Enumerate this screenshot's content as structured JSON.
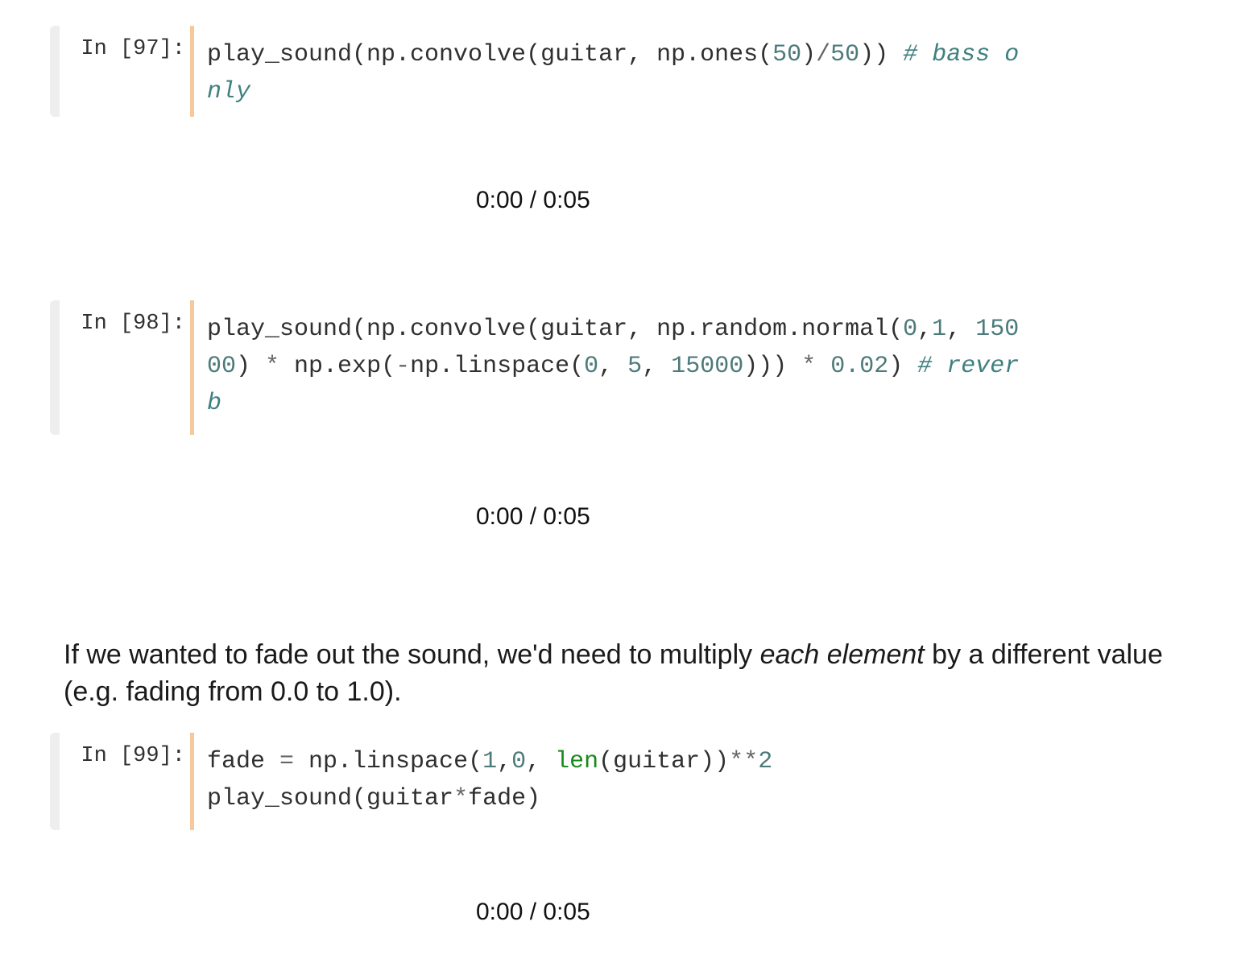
{
  "cells": [
    {
      "prompt": "In [97]:",
      "code_lines": [
        [
          {
            "t": "play_sound(np.convolve(guitar, np.ones(",
            "c": ""
          },
          {
            "t": "50",
            "c": "num"
          },
          {
            "t": ")",
            "c": ""
          },
          {
            "t": "/",
            "c": "op"
          },
          {
            "t": "50",
            "c": "num"
          },
          {
            "t": ")) ",
            "c": ""
          },
          {
            "t": "# bass o",
            "c": "cm"
          }
        ],
        [
          {
            "t": "nly",
            "c": "cm"
          }
        ]
      ],
      "output": "0:00 / 0:05"
    },
    {
      "prompt": "In [98]:",
      "code_lines": [
        [
          {
            "t": "play_sound(np.convolve(guitar, np.random.normal(",
            "c": ""
          },
          {
            "t": "0",
            "c": "num"
          },
          {
            "t": ",",
            "c": ""
          },
          {
            "t": "1",
            "c": "num"
          },
          {
            "t": ", ",
            "c": ""
          },
          {
            "t": "150",
            "c": "num"
          }
        ],
        [
          {
            "t": "00",
            "c": "num"
          },
          {
            "t": ") ",
            "c": ""
          },
          {
            "t": "*",
            "c": "op"
          },
          {
            "t": " np.exp(",
            "c": ""
          },
          {
            "t": "-",
            "c": "op"
          },
          {
            "t": "np.linspace(",
            "c": ""
          },
          {
            "t": "0",
            "c": "num"
          },
          {
            "t": ", ",
            "c": ""
          },
          {
            "t": "5",
            "c": "num"
          },
          {
            "t": ", ",
            "c": ""
          },
          {
            "t": "15000",
            "c": "num"
          },
          {
            "t": "))) ",
            "c": ""
          },
          {
            "t": "*",
            "c": "op"
          },
          {
            "t": " ",
            "c": ""
          },
          {
            "t": "0.02",
            "c": "num"
          },
          {
            "t": ") ",
            "c": ""
          },
          {
            "t": "# rever",
            "c": "cm"
          }
        ],
        [
          {
            "t": "b",
            "c": "cm"
          }
        ]
      ],
      "output": "0:00 / 0:05"
    },
    {
      "prompt": "In [99]:",
      "code_lines": [
        [
          {
            "t": "fade ",
            "c": ""
          },
          {
            "t": "=",
            "c": "op"
          },
          {
            "t": " np.linspace(",
            "c": ""
          },
          {
            "t": "1",
            "c": "num"
          },
          {
            "t": ",",
            "c": ""
          },
          {
            "t": "0",
            "c": "num"
          },
          {
            "t": ", ",
            "c": ""
          },
          {
            "t": "len",
            "c": "bi"
          },
          {
            "t": "(guitar))",
            "c": ""
          },
          {
            "t": "**",
            "c": "op"
          },
          {
            "t": "2",
            "c": "num"
          }
        ],
        [
          {
            "t": "play_sound(guitar",
            "c": ""
          },
          {
            "t": "*",
            "c": "op"
          },
          {
            "t": "fade)",
            "c": ""
          }
        ]
      ],
      "output": "0:00 / 0:05"
    }
  ],
  "markdown": {
    "before": "If we wanted to fade out the sound, we'd need to multiply ",
    "emphasis": "each element",
    "after": " by a different value (e.g. fading from 0.0 to 1.0)."
  }
}
